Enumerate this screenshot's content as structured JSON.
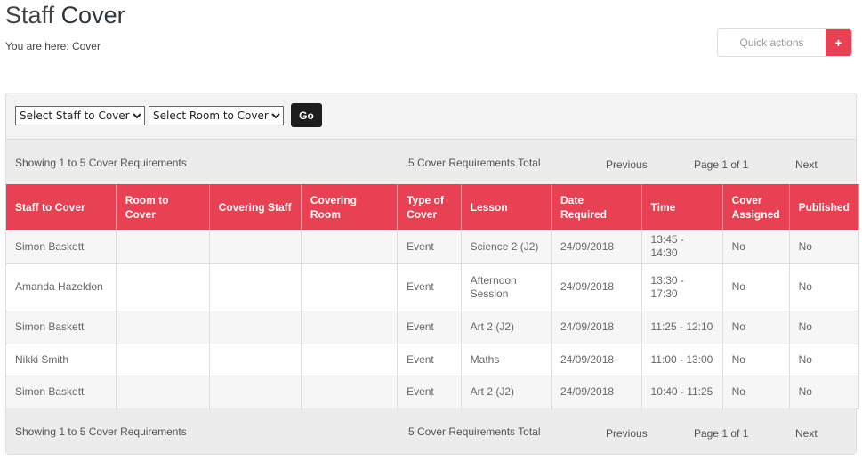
{
  "header": {
    "title_light": "Staff",
    "title_bold": "Cover",
    "breadcrumb": "You are here: Cover",
    "quick_actions": "Quick actions",
    "plus": "+"
  },
  "filters": {
    "staff": "Select Staff to Cover",
    "room": "Select Room to Cover",
    "go": "Go"
  },
  "pager": {
    "showing": "Showing 1 to 5 Cover Requirements",
    "total": "5 Cover Requirements Total",
    "previous": "Previous",
    "page": "Page 1 of 1",
    "next": "Next"
  },
  "columns": [
    "Staff to Cover",
    "Room to Cover",
    "Covering Staff",
    "Covering Room",
    "Type of Cover",
    "Lesson",
    "Date Required",
    "Time",
    "Cover Assigned",
    "Published"
  ],
  "rows": [
    [
      "Simon Baskett",
      "",
      "",
      "",
      "Event",
      "Science 2 (J2)",
      "24/09/2018",
      "13:45 - 14:30",
      "No",
      "No"
    ],
    [
      "Amanda Hazeldon",
      "",
      "",
      "",
      "Event",
      "Afternoon Session",
      "24/09/2018",
      "13:30 - 17:30",
      "No",
      "No"
    ],
    [
      "Simon Baskett",
      "",
      "",
      "",
      "Event",
      "Art 2 (J2)",
      "24/09/2018",
      "11:25 - 12:10",
      "No",
      "No"
    ],
    [
      "Nikki Smith",
      "",
      "",
      "",
      "Event",
      "Maths",
      "24/09/2018",
      "11:00 - 13:00",
      "No",
      "No"
    ],
    [
      "Simon Baskett",
      "",
      "",
      "",
      "Event",
      "Art 2 (J2)",
      "24/09/2018",
      "10:40 - 11:25",
      "No",
      "No"
    ]
  ],
  "colors": {
    "accent": "#e84153"
  }
}
